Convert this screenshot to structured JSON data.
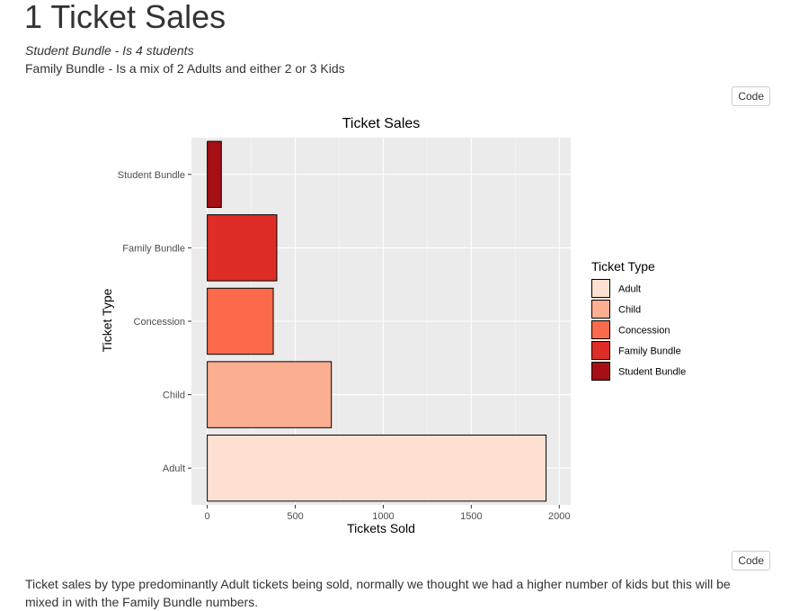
{
  "page": {
    "title": "1 Ticket Sales",
    "subtitle_italic": "Student Bundle - Is 4 students",
    "subtitle": "Family Bundle - Is a mix of 2 Adults and either 2 or 3 Kids",
    "code_button_label": "Code",
    "footer": "Ticket sales by type predominantly Adult tickets being sold, normally we thought we had a higher number of kids but this will be mixed in with the Family Bundle numbers."
  },
  "chart_data": {
    "type": "bar",
    "orientation": "horizontal",
    "title": "Ticket Sales",
    "xlabel": "Tickets Sold",
    "ylabel": "Ticket Type",
    "categories": [
      "Adult",
      "Child",
      "Concession",
      "Family Bundle",
      "Student Bundle"
    ],
    "values": [
      1925,
      705,
      375,
      395,
      80
    ],
    "colors": [
      "#FEE0D2",
      "#FCAE91",
      "#FB6A4A",
      "#DE2D26",
      "#A50F15"
    ],
    "xlim": [
      -90,
      2065
    ],
    "xticks": [
      0,
      500,
      1000,
      1500,
      2000
    ],
    "grid": true,
    "panel_background": "#EBEBEB",
    "legend": {
      "title": "Ticket Type",
      "position": "right",
      "entries": [
        "Adult",
        "Child",
        "Concession",
        "Family Bundle",
        "Student Bundle"
      ]
    }
  }
}
